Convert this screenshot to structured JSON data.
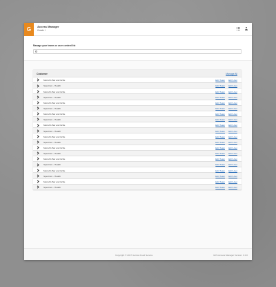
{
  "header": {
    "logo_letter": "G",
    "title": "Access Manager",
    "subtitle": "Create +"
  },
  "search": {
    "label": "Manage your teams or user content list",
    "placeholder": ""
  },
  "table": {
    "col_customer": "Customer",
    "manage_all": "Manage All",
    "rows": [
      {
        "name": "Merrell's Bar and Grille",
        "team": "Edit Team",
        "user": "Edit User"
      },
      {
        "name": "Spectrum - Health",
        "team": "Edit Team",
        "user": "Edit User"
      },
      {
        "name": "Merrell's Bar and Grille",
        "team": "Edit Team",
        "user": "Edit User"
      },
      {
        "name": "Spectrum - Health",
        "team": "Edit Team",
        "user": "Edit User"
      },
      {
        "name": "Merrell's Bar and Grille",
        "team": "Edit Team",
        "user": "Edit User"
      },
      {
        "name": "Spectrum - Health",
        "team": "Edit Team",
        "user": "Edit User"
      },
      {
        "name": "Merrell's Bar and Grille",
        "team": "Edit Team",
        "user": "Edit User"
      },
      {
        "name": "Spectrum - Health",
        "team": "Edit Team",
        "user": "Edit User"
      },
      {
        "name": "Merrell's Bar and Grille",
        "team": "Edit Team",
        "user": "Edit User"
      },
      {
        "name": "Spectrum - Health",
        "team": "Edit Team",
        "user": "Edit User"
      },
      {
        "name": "Merrell's Bar and Grille",
        "team": "Edit Team",
        "user": "Edit User"
      },
      {
        "name": "Spectrum - Health",
        "team": "Edit Team",
        "user": "Edit User"
      },
      {
        "name": "Merrell's Bar and Grille",
        "team": "Edit Team",
        "user": "Edit User"
      },
      {
        "name": "Spectrum - Health",
        "team": "Edit Team",
        "user": "Edit User"
      },
      {
        "name": "Merrell's Bar and Grille",
        "team": "Edit Team",
        "user": "Edit User"
      },
      {
        "name": "Spectrum - Health",
        "team": "Edit Team",
        "user": "Edit User"
      },
      {
        "name": "Merrell's Bar and Grille",
        "team": "Edit Team",
        "user": "Edit User"
      },
      {
        "name": "Spectrum - Health",
        "team": "Edit Team",
        "user": "Edit User"
      },
      {
        "name": "Merrell's Bar and Grille",
        "team": "Edit Team",
        "user": "Edit User"
      },
      {
        "name": "Spectrum - Health",
        "team": "Edit Team",
        "user": "Edit User"
      }
    ]
  },
  "footer": {
    "copyright": "Copyright © 2017 Gordon Food Service",
    "version": "GFS Access Manager Version: 0.0.0"
  },
  "colors": {
    "brand": "#e8891e",
    "link": "#2a6db7"
  }
}
